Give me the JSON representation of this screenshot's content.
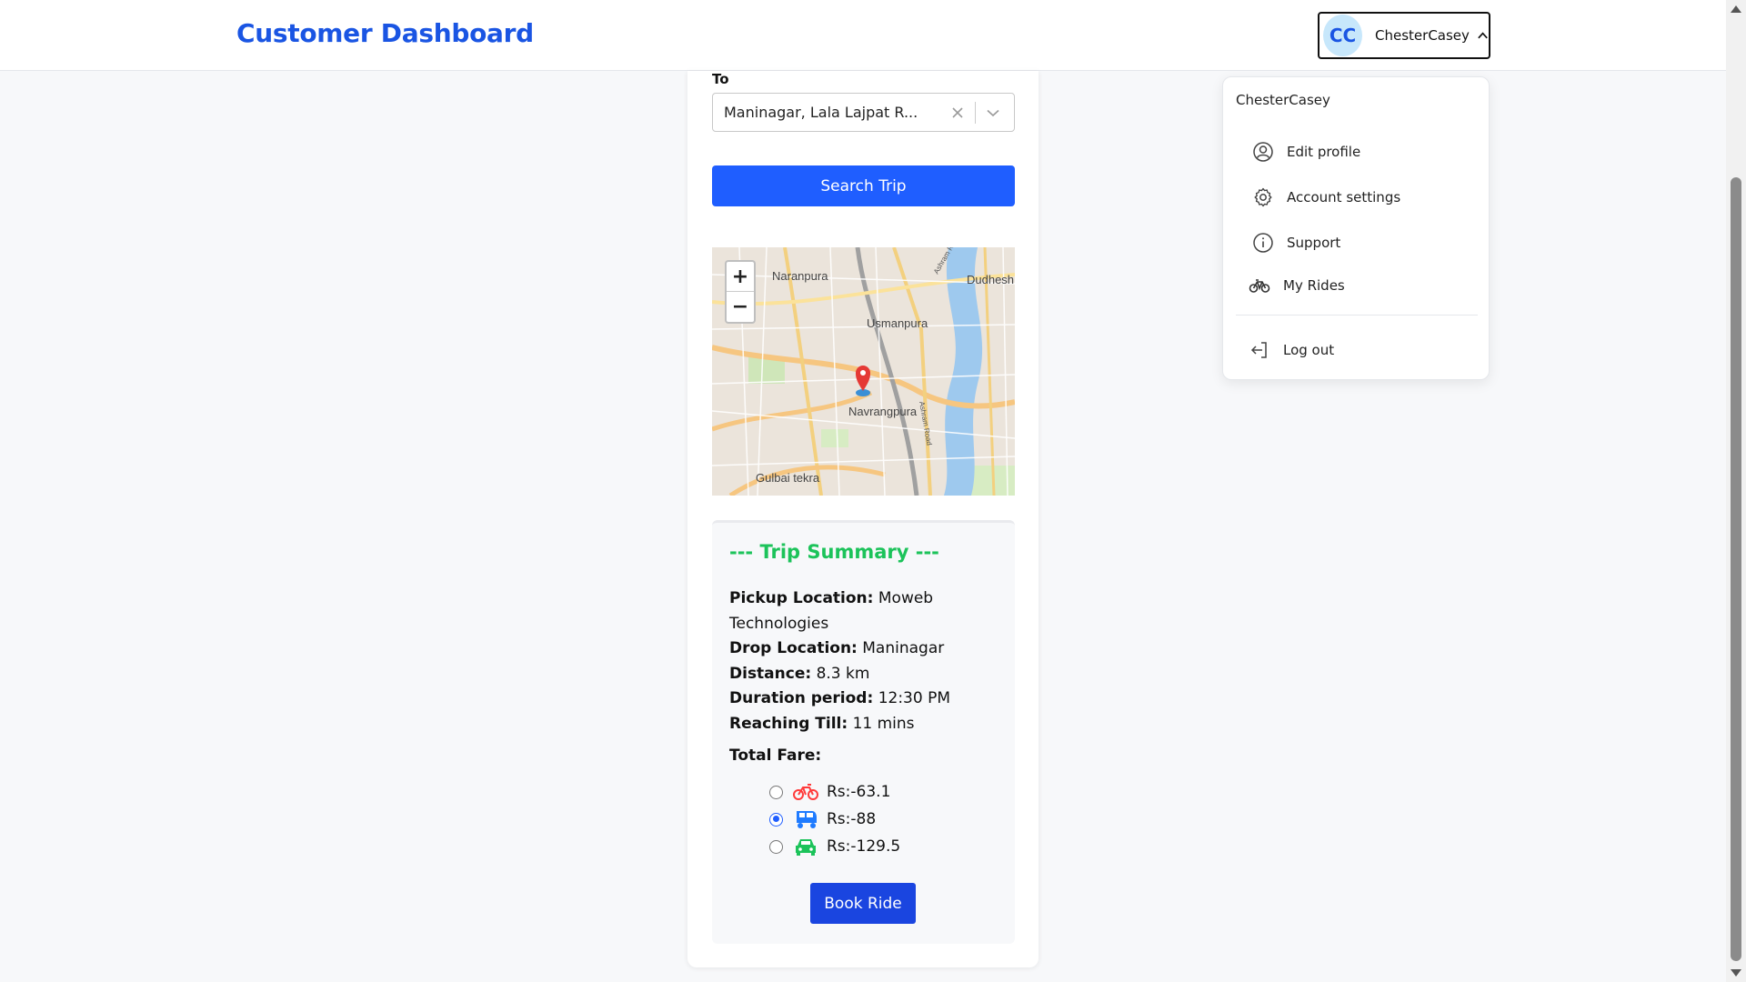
{
  "header": {
    "title": "Customer Dashboard",
    "user": {
      "initials": "CC",
      "name": "ChesterCasey"
    }
  },
  "dropdown": {
    "title": "ChesterCasey",
    "items": [
      {
        "label": "Edit profile",
        "icon": "user-circle-icon"
      },
      {
        "label": "Account settings",
        "icon": "gear-icon"
      },
      {
        "label": "Support",
        "icon": "info-icon"
      },
      {
        "label": "My Rides",
        "icon": "bicycle-icon"
      },
      {
        "label": "Log out",
        "icon": "logout-icon"
      }
    ]
  },
  "form": {
    "to_label": "To",
    "to_value": "Maninagar, Lala Lajpat R...",
    "search_button": "Search Trip"
  },
  "map": {
    "labels": [
      "Naranpura",
      "Usmanpura",
      "Navrangpura",
      "Gulbai tekra",
      "Dudhesh",
      "Ashram Road",
      "Ashram Road"
    ],
    "zoom_in": "+",
    "zoom_out": "−"
  },
  "summary": {
    "title": "--- Trip Summary ---",
    "pickup_label": "Pickup Location:",
    "pickup_value": "Moweb Technologies",
    "drop_label": "Drop Location:",
    "drop_value": "Maninagar",
    "distance_label": "Distance:",
    "distance_value": "8.3 km",
    "duration_label": "Duration period:",
    "duration_value": "12:30 PM",
    "reaching_label": "Reaching Till:",
    "reaching_value": "11 mins",
    "fare_label": "Total Fare:",
    "fares": [
      {
        "vehicle": "bike",
        "icon": "bike-icon",
        "value": "Rs:-63.1",
        "selected": false,
        "color": "#ff3b3b"
      },
      {
        "vehicle": "auto",
        "icon": "rickshaw-icon",
        "value": "Rs:-88",
        "selected": true,
        "color": "#1f7bff"
      },
      {
        "vehicle": "car",
        "icon": "car-icon",
        "value": "Rs:-129.5",
        "selected": false,
        "color": "#1cc35a"
      }
    ],
    "book_button": "Book Ride"
  },
  "colors": {
    "primary": "#1f5eff",
    "brand": "#1a55e3",
    "summary_title": "#1cc35a"
  }
}
